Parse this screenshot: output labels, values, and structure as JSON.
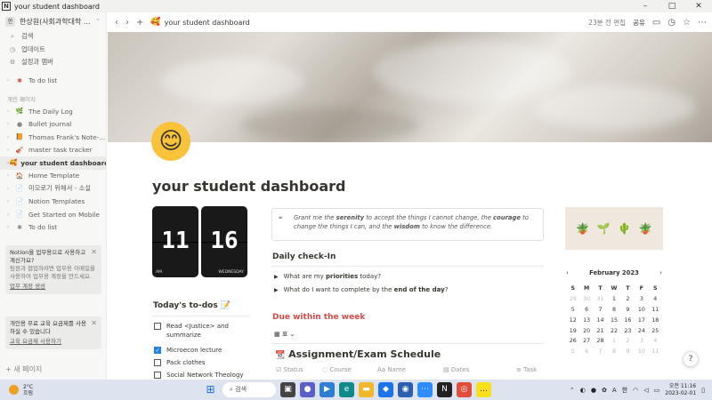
{
  "window": {
    "title": "your student dashboard",
    "controls": [
      "–",
      "□",
      "✕"
    ]
  },
  "sidebar": {
    "workspace": "한상원(사회과학대학 ...",
    "top_items": [
      {
        "icon": "search-icon",
        "glyph": "⌕",
        "label": "검색"
      },
      {
        "icon": "clock-icon",
        "glyph": "◷",
        "label": "업데이트"
      },
      {
        "icon": "gear-icon",
        "glyph": "⚙",
        "label": "설정과 멤버"
      }
    ],
    "pinned": {
      "label": "To do list",
      "glyph": "✱"
    },
    "section_label": "개인 페이지",
    "pages": [
      {
        "label": "The Daily Log",
        "glyph": "🌿",
        "active": false
      },
      {
        "label": "Bullet journal",
        "glyph": "●",
        "active": false
      },
      {
        "label": "Thomas Frank's Note-...",
        "glyph": "📙",
        "active": false
      },
      {
        "label": "master task tracker",
        "glyph": "🎻",
        "active": false
      },
      {
        "label": "your student dashboard",
        "glyph": "🥰",
        "active": true
      },
      {
        "label": "Home Template",
        "glyph": "🏠",
        "active": false
      },
      {
        "label": "미오로기 위해서 - 소설",
        "glyph": "📄",
        "active": false
      },
      {
        "label": "Notion Templates",
        "glyph": "📄",
        "active": false
      },
      {
        "label": "Get Started on Mobile",
        "glyph": "📄",
        "active": false
      },
      {
        "label": "To do list",
        "glyph": "✱",
        "active": false
      }
    ],
    "card1": {
      "title": "Notion을 업무용으로 사용하고 계신가요?",
      "body": "팀원과 협업하려면 업무용 이메일을 사용하여 업무용 계정을 만드세요.",
      "link": "업무 계정 생성"
    },
    "card2": {
      "title": "개인용 무료 교육 요금제를 사용하실 수 있습니다",
      "link": "교육 요금제 사용하기"
    },
    "new_page": "+ 새 페이지"
  },
  "topbar": {
    "breadcrumb": "your student dashboard",
    "edited": "23분 전 편집",
    "share": "공유"
  },
  "page": {
    "title": "your student dashboard",
    "emoji": "😊",
    "clock": {
      "hour": "11",
      "minute": "16",
      "ampm": "AM",
      "day": "WEDNESDAY"
    },
    "quote": {
      "p1": "Grant me the ",
      "b1": "serenity",
      "p2": " to accept the things I cannot change, the ",
      "b2": "courage",
      "p3": " to change the things I can, and the ",
      "b3": "wisdom",
      "p4": " to know the difference."
    },
    "checkin": {
      "heading": "Daily check-In",
      "q1_a": "What are my ",
      "q1_b": "priorities",
      "q1_c": " today?",
      "q2_a": "What do I want to complete by the ",
      "q2_b": "end of the day",
      "q2_c": "?"
    },
    "todos": {
      "heading": "Today's to-dos 📝",
      "items": [
        {
          "label": "Read <Justice> and summarize",
          "checked": false
        },
        {
          "label": "Microecon lecture",
          "checked": true
        },
        {
          "label": "Pack clothes",
          "checked": false
        },
        {
          "label": "Social Network Theology",
          "checked": false
        }
      ]
    },
    "due": {
      "heading": "Due within the week",
      "view": "표"
    },
    "assignments": {
      "heading": "Assignment/Exam Schedule",
      "columns": [
        "Status",
        "Course",
        "Name",
        "Dates",
        "Task"
      ]
    },
    "calendar": {
      "month": "February 2023",
      "dow": [
        "S",
        "M",
        "T",
        "W",
        "T",
        "F",
        "S"
      ],
      "weeks": [
        [
          "29",
          "30",
          "31",
          "1",
          "2",
          "3",
          "4"
        ],
        [
          "5",
          "6",
          "7",
          "8",
          "9",
          "10",
          "11"
        ],
        [
          "12",
          "13",
          "14",
          "15",
          "16",
          "17",
          "18"
        ],
        [
          "19",
          "20",
          "21",
          "22",
          "23",
          "24",
          "25"
        ],
        [
          "26",
          "27",
          "28",
          "1",
          "2",
          "3",
          "4"
        ],
        [
          "5",
          "6",
          "7",
          "8",
          "9",
          "10",
          "11"
        ]
      ]
    }
  },
  "taskbar": {
    "temp": "2°C",
    "weather": "흐림",
    "search": "검색",
    "tray_lang": "한",
    "tray_a": "A",
    "time": "오전 11:16",
    "date": "2023-02-01"
  }
}
